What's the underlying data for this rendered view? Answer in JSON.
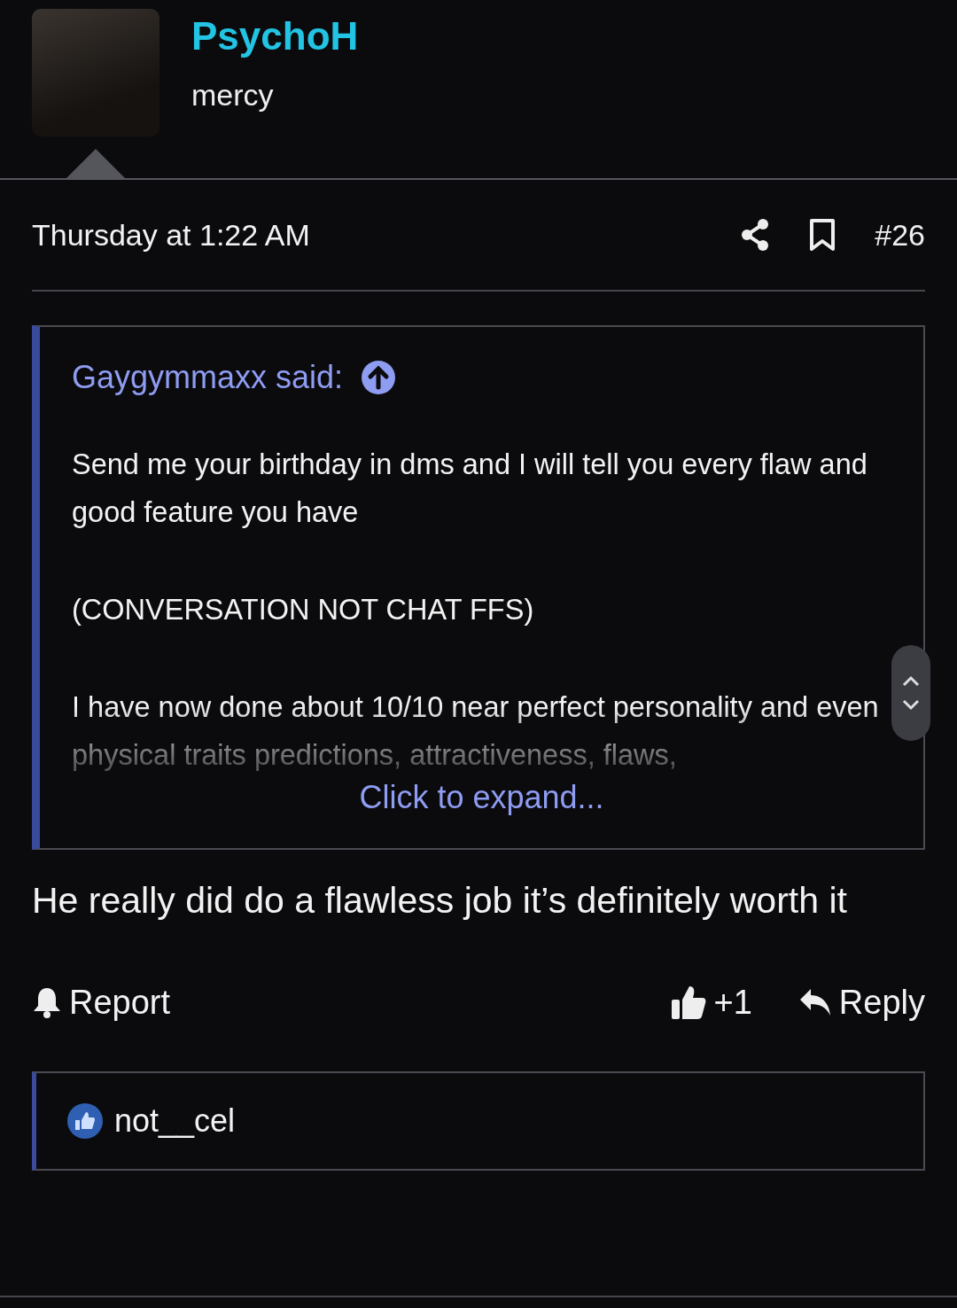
{
  "author": {
    "name": "PsychoH",
    "title": "mercy"
  },
  "post": {
    "date": "Thursday at 1:22 AM",
    "number": "#26",
    "quote": {
      "author": "Gaygymmaxx said:",
      "paragraphs": [
        "Send me your birthday in dms and I will tell you every flaw and good feature you have",
        "(CONVERSATION NOT CHAT FFS)",
        "I have now done about 10/10 near perfect personality and even physical traits predictions, attractiveness, flaws,"
      ],
      "expand": "Click to expand..."
    },
    "body": "He really did do a flawless job it’s definitely worth it",
    "actions": {
      "report": "Report",
      "like": "+1",
      "reply": "Reply"
    },
    "reactions": [
      {
        "user": "not__cel"
      }
    ]
  }
}
